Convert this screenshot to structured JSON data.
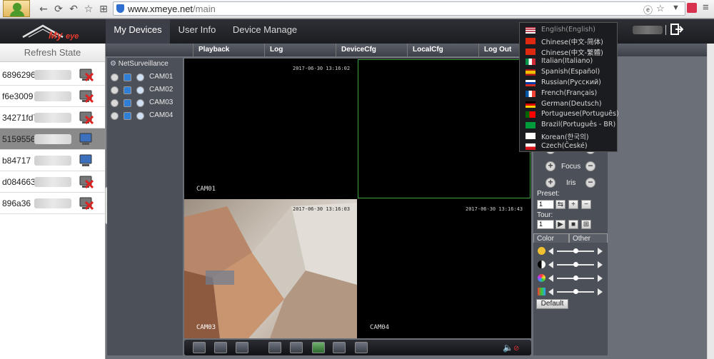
{
  "browser": {
    "url_host": "www.xmeye.net",
    "url_path": "/main"
  },
  "header": {
    "tabs": [
      {
        "label": "My Devices",
        "active": true
      },
      {
        "label": "User Info",
        "active": false
      },
      {
        "label": "Device Manage",
        "active": false
      }
    ]
  },
  "sidebar": {
    "title": "Refresh State",
    "devices": [
      {
        "id": "6896296",
        "selected": false,
        "online": false
      },
      {
        "id": "f6e3009",
        "selected": false,
        "online": false
      },
      {
        "id": "34271fd7",
        "selected": false,
        "online": false
      },
      {
        "id": "5159556",
        "selected": true,
        "online": true
      },
      {
        "id": "b84717",
        "selected": false,
        "online": true
      },
      {
        "id": "d084663",
        "selected": false,
        "online": false
      },
      {
        "id": "896a36",
        "selected": false,
        "online": false
      }
    ]
  },
  "subtoolbar": {
    "items": [
      "Playback",
      "Log",
      "DeviceCfg",
      "LocalCfg",
      "Log Out"
    ]
  },
  "channels": {
    "root": "NetSurveillance",
    "cams": [
      "CAM01",
      "CAM02",
      "CAM03",
      "CAM04"
    ]
  },
  "video": {
    "cells": [
      {
        "label": "CAM01",
        "time": "2017-06-30 13:16:02"
      },
      {
        "label": "",
        "time": ""
      },
      {
        "label": "CAM03",
        "time": "2017-06-30 13:16:03"
      },
      {
        "label": "CAM04",
        "time": "2017-06-30 13:16:43"
      }
    ]
  },
  "ptz": {
    "focus_label": "Focus",
    "iris_label": "Iris",
    "preset_label": "Preset:",
    "preset_value": "1",
    "tour_label": "Tour:",
    "tour_value": "1",
    "tab_color": "Color",
    "tab_other": "Other",
    "default_label": "Default",
    "sliders": [
      {
        "icon": "brightness-icon",
        "value": 0.5
      },
      {
        "icon": "contrast-icon",
        "value": 0.5
      },
      {
        "icon": "saturation-icon",
        "value": 0.5
      },
      {
        "icon": "hue-icon",
        "value": 0.5
      }
    ]
  },
  "language_menu": {
    "items": [
      {
        "label": "English(English)",
        "flag": "us"
      },
      {
        "label": "Chinese(中文-简体)",
        "flag": "cn"
      },
      {
        "label": "Chinese(中文-繁體)",
        "flag": "cn"
      },
      {
        "label": "Italian(Italiano)",
        "flag": "it"
      },
      {
        "label": "Spanish(Español)",
        "flag": "es"
      },
      {
        "label": "Russian(Русский)",
        "flag": "ru"
      },
      {
        "label": "French(Français)",
        "flag": "fr"
      },
      {
        "label": "German(Deutsch)",
        "flag": "de"
      },
      {
        "label": "Portuguese(Português)",
        "flag": "pt"
      },
      {
        "label": "Brazil(Português - BR)",
        "flag": "br"
      },
      {
        "label": "Korean(한국의)",
        "flag": "kr"
      },
      {
        "label": "Czech(České)",
        "flag": "cz"
      }
    ]
  }
}
